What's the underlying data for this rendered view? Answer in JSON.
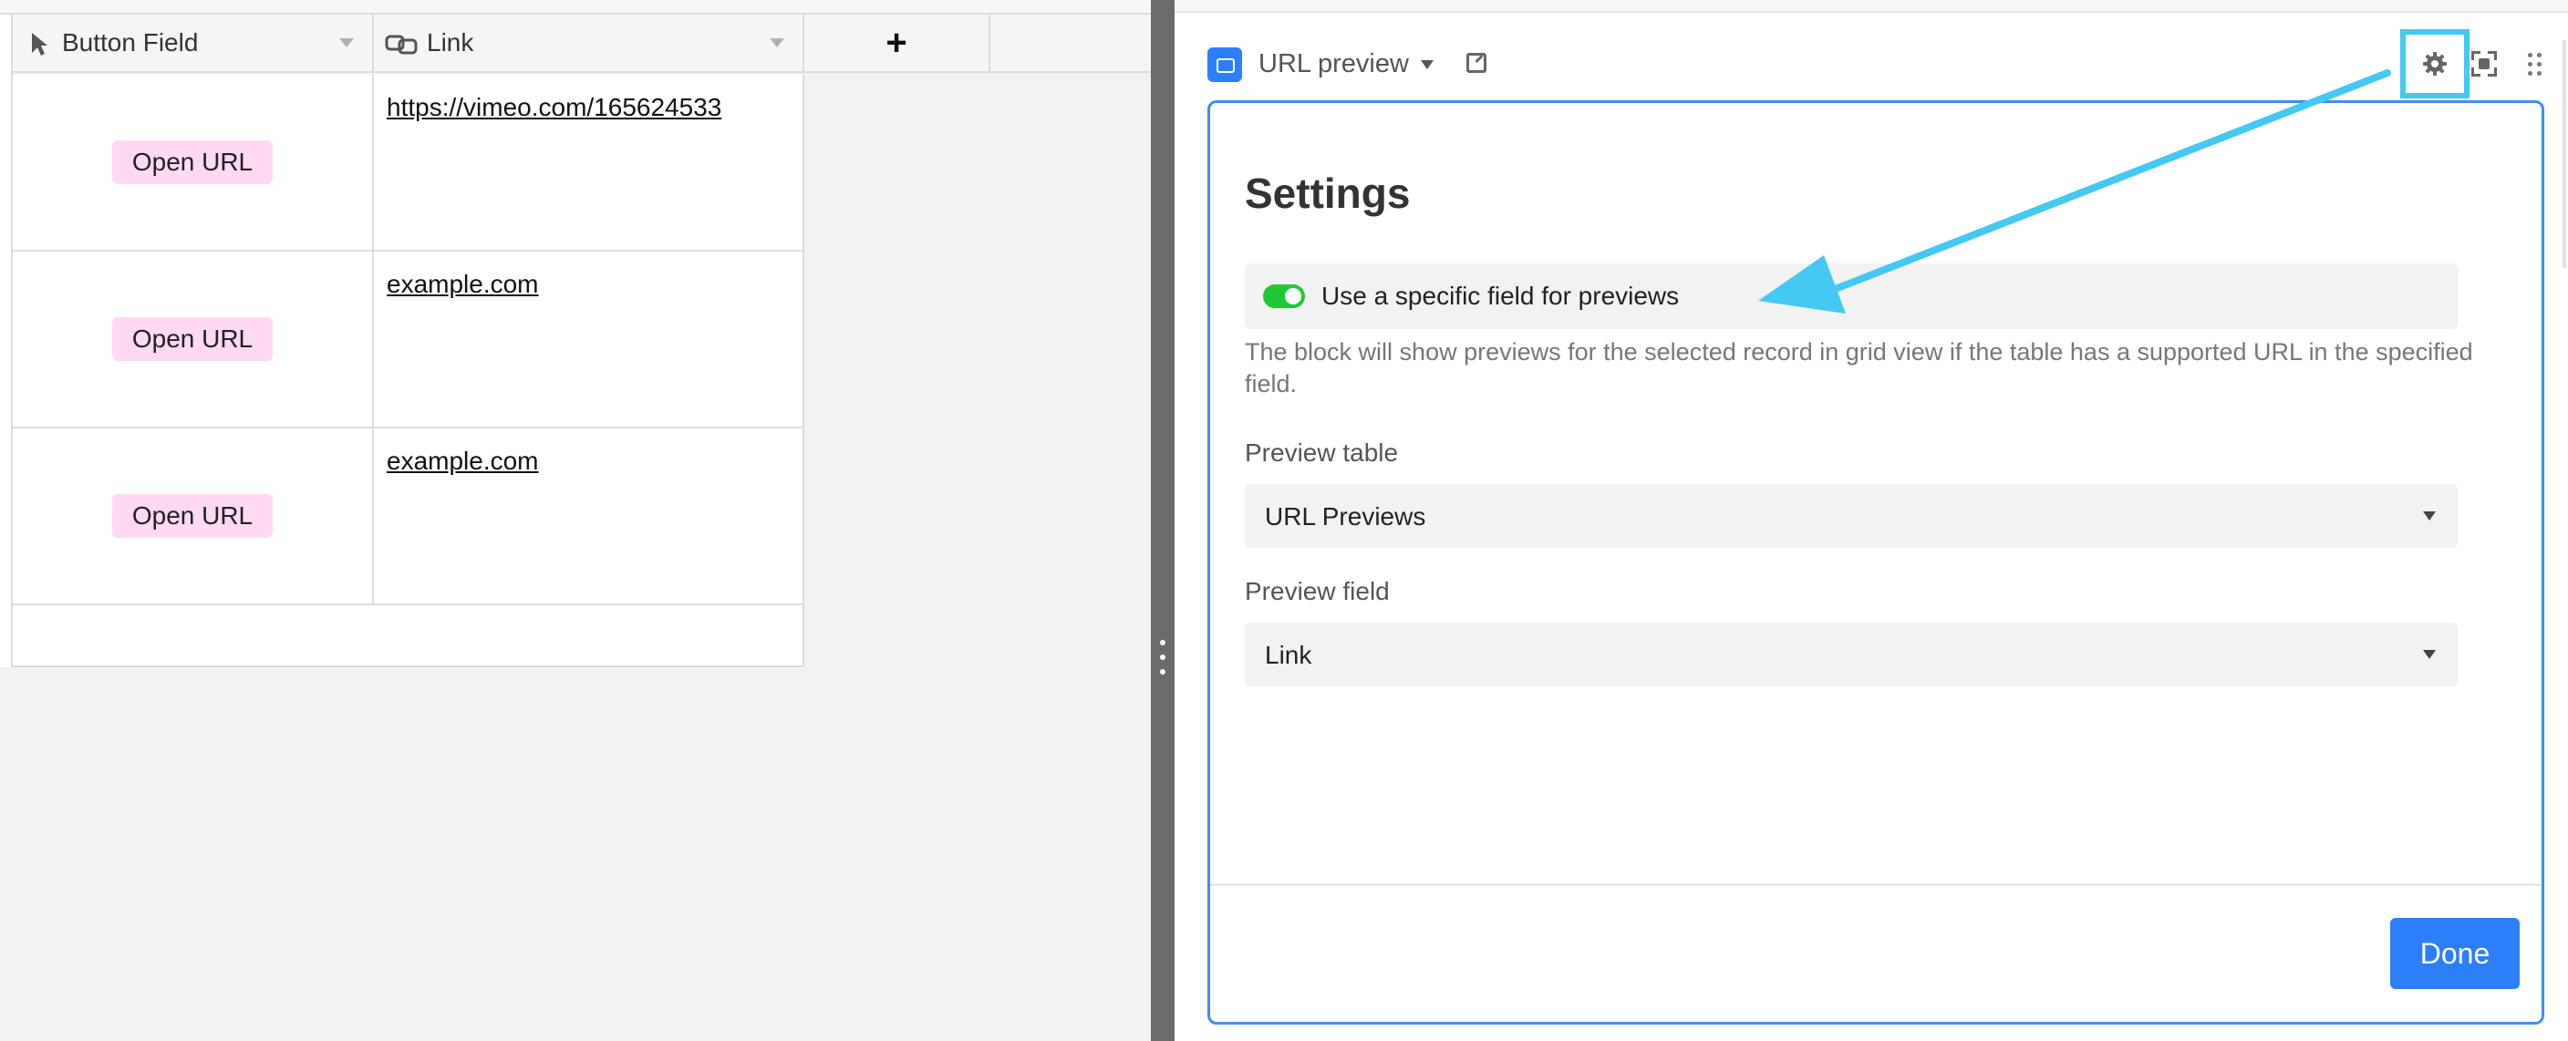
{
  "grid": {
    "columns": [
      {
        "name": "Button Field",
        "icon": "cursor-icon"
      },
      {
        "name": "Link",
        "icon": "link-icon"
      }
    ],
    "add_column_label": "+",
    "rows": [
      {
        "button": "Open URL",
        "link": "https://vimeo.com/165624533"
      },
      {
        "button": "Open URL",
        "link": "example.com"
      },
      {
        "button": "Open URL",
        "link": "example.com"
      }
    ]
  },
  "block": {
    "title": "URL preview",
    "icon": "url-preview-block-icon",
    "accent_color": "#2d7ff9"
  },
  "settings": {
    "heading": "Settings",
    "toggle_label": "Use a specific field for previews",
    "toggle_on": true,
    "toggle_color": "#20c933",
    "help_text": "The block will show previews for the selected record in grid view if the table has a supported URL in the specified field.",
    "preview_table_label": "Preview table",
    "preview_table_value": "URL Previews",
    "preview_field_label": "Preview field",
    "preview_field_value": "Link",
    "done_label": "Done"
  },
  "annotation": {
    "highlight_color": "#45c8f1",
    "target": "gear-icon"
  }
}
